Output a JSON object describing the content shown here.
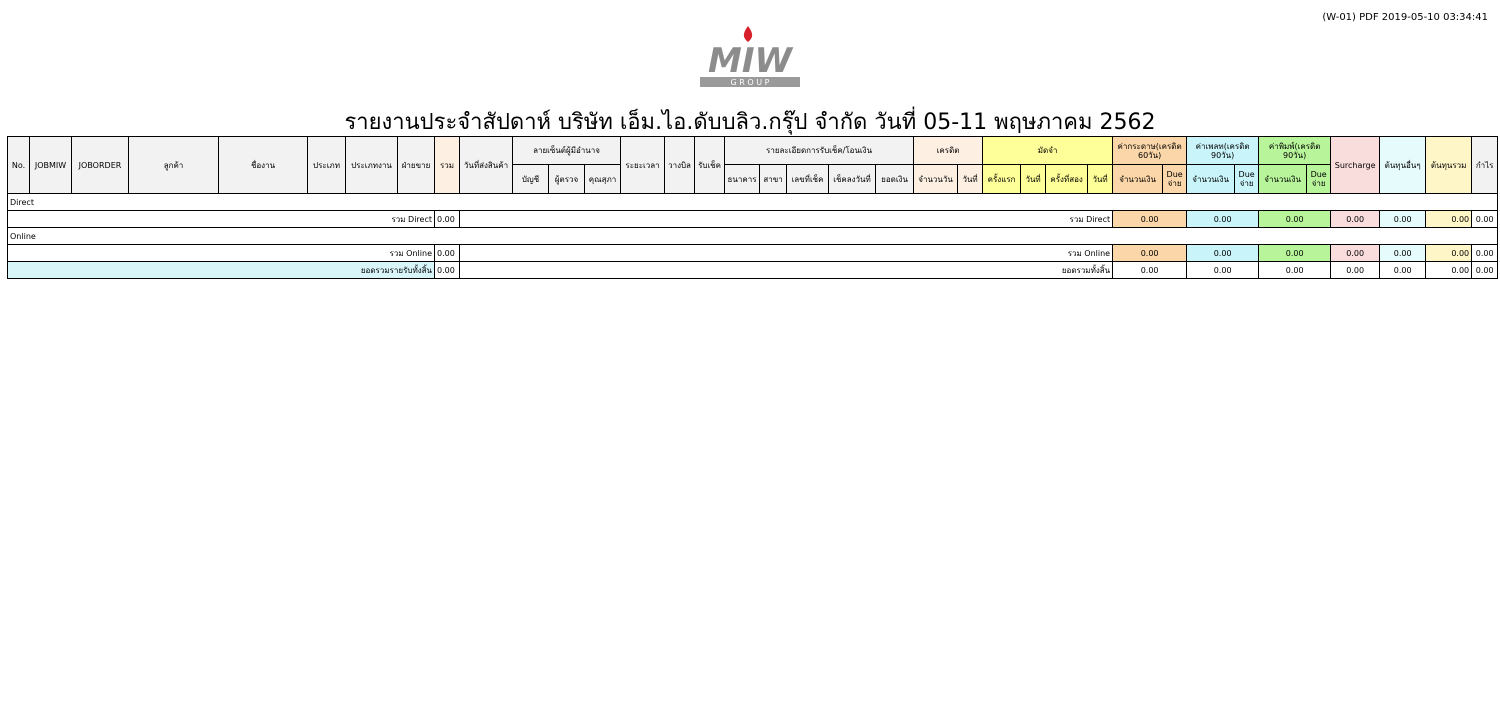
{
  "header": {
    "stamp": "(W-01) PDF 2019-05-10 03:34:41"
  },
  "logo": {
    "text": "MIW",
    "sub": "G R O U P",
    "flame_color": "#d8202a",
    "text_color": "#8c8c8c"
  },
  "title": "รายงานประจำสัปดาห์ บริษัท เอ็ม.ไอ.ดับบลิว.กรุ๊ป จำกัด วันที่ 05-11 พฤษภาคม 2562",
  "columns": {
    "no": "No.",
    "jobmiw": "JOBMIW",
    "joborder": "JOBORDER",
    "customer": "ลูกค้า",
    "jobname": "ชื่องาน",
    "type": "ประเภท",
    "jobtype": "ประเภทงาน",
    "sales": "ฝ่ายขาย",
    "sum": "รวม",
    "delivery": "วันที่ส่งสินค้า",
    "sign_group": "ลายเซ็นต์ผู้มีอำนาจ",
    "sign_acc": "บัญชี",
    "sign_check": "ผู้ตรวจ",
    "sign_boss": "คุณสุภา",
    "period": "ระยะเวลา",
    "billing": "วางบิล",
    "cheque": "รับเช็ค",
    "pay_group": "รายละเอียดการรับเช็ค/โอนเงิน",
    "bank": "ธนาคาร",
    "branch": "สาขา",
    "cheque_no": "เลขที่เช็ค",
    "cheque_date": "เช็คลงวันที่",
    "amount": "ยอดเงิน",
    "credit_group": "เครดิต",
    "credit_days": "จำนวนวัน",
    "credit_date": "วันที่",
    "deposit_group": "มัดจำ",
    "dep_first": "ครั้งแรก",
    "dep_date1": "วันที่",
    "dep_second": "ครั้งที่สอง",
    "dep_date2": "วันที่",
    "paper_group": "ค่ากระดาษ(เครดิต 60วัน)",
    "plate_group": "ค่าเพลท(เครดิต 90วัน)",
    "print_group": "ค่าพิมพ์(เครดิต 90วัน)",
    "money": "จำนวนเงิน",
    "due": "Due จ่าย",
    "surcharge": "Surcharge",
    "other_cost": "ต้นทุนอื่นๆ",
    "total_cost": "ต้นทุนรวม",
    "profit": "กำไร"
  },
  "sections": {
    "direct": {
      "label": "Direct",
      "left_label": "รวม Direct",
      "left_sum": "0.00",
      "right_label": "รวม Direct",
      "paper": "0.00",
      "plate": "0.00",
      "print": "0.00",
      "surcharge": "0.00",
      "other": "0.00",
      "total": "0.00",
      "profit": "0.00"
    },
    "online": {
      "label": "Online",
      "left_label": "รวม Online",
      "left_sum": "0.00",
      "right_label": "รวม Online",
      "paper": "0.00",
      "plate": "0.00",
      "print": "0.00",
      "surcharge": "0.00",
      "other": "0.00",
      "total": "0.00",
      "profit": "0.00"
    }
  },
  "grand": {
    "left_label": "ยอดรวมรายรับทั้งสิ้น",
    "left_sum": "0.00",
    "right_label": "ยอดรวมทั้งสิ้น",
    "paper": "0.00",
    "plate": "0.00",
    "print": "0.00",
    "surcharge": "0.00",
    "other": "0.00",
    "total": "0.00",
    "profit": "0.00"
  }
}
